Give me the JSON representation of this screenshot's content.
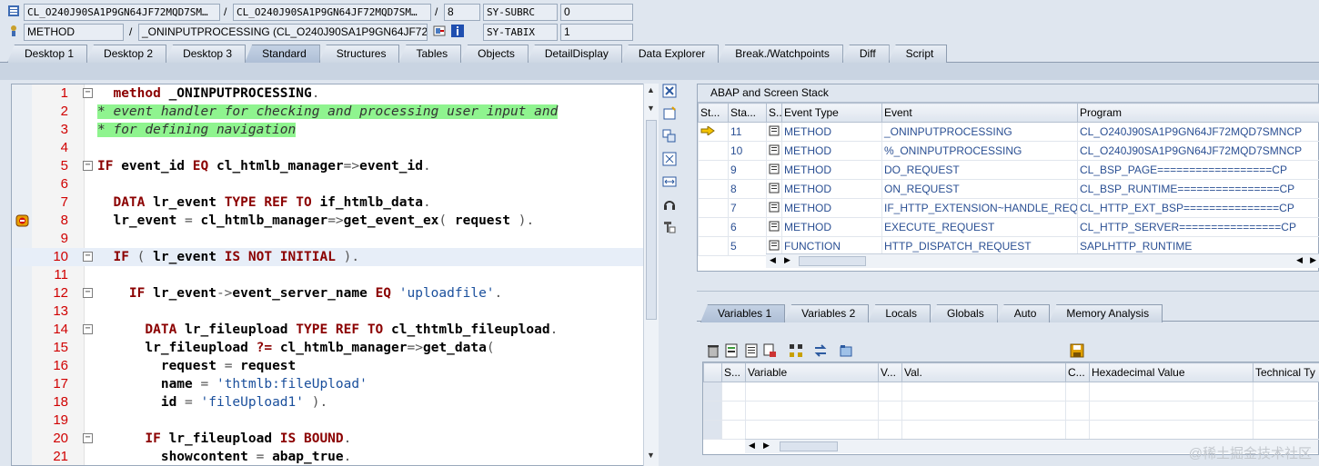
{
  "topbar": {
    "row1": {
      "class_field": "CL_O240J90SA1P9GN64JF72MQD7SM…",
      "class_field2": "CL_O240J90SA1P9GN64JF72MQD7SM…",
      "slash": "/",
      "line": "8",
      "sy_label": "SY-SUBRC",
      "sy_value": "0"
    },
    "row2": {
      "type_field": "METHOD",
      "slash": "/",
      "method_field": "_ONINPUTPROCESSING (CL_O240J90SA1P9GN64JF72…",
      "sy_label": "SY-TABIX",
      "sy_value": "1"
    }
  },
  "main_tabs": [
    "Desktop 1",
    "Desktop 2",
    "Desktop 3",
    "Standard",
    "Structures",
    "Tables",
    "Objects",
    "DetailDisplay",
    "Data Explorer",
    "Break./Watchpoints",
    "Diff",
    "Script"
  ],
  "active_main_tab": "Standard",
  "code": {
    "lines": [
      {
        "n": "1",
        "fold": "−",
        "html_key": "l1"
      },
      {
        "n": "2",
        "fold": "",
        "html_key": "l2"
      },
      {
        "n": "3",
        "fold": "",
        "html_key": "l3"
      },
      {
        "n": "4",
        "fold": "",
        "html_key": "l4"
      },
      {
        "n": "5",
        "fold": "−",
        "html_key": "l5"
      },
      {
        "n": "6",
        "fold": "",
        "html_key": "l6"
      },
      {
        "n": "7",
        "fold": "",
        "html_key": "l7"
      },
      {
        "n": "8",
        "fold": "",
        "html_key": "l8"
      },
      {
        "n": "9",
        "fold": "",
        "html_key": "l9"
      },
      {
        "n": "10",
        "fold": "−",
        "html_key": "l10"
      },
      {
        "n": "11",
        "fold": "",
        "html_key": "l11"
      },
      {
        "n": "12",
        "fold": "−",
        "html_key": "l12"
      },
      {
        "n": "13",
        "fold": "",
        "html_key": "l13"
      },
      {
        "n": "14",
        "fold": "−",
        "html_key": "l14"
      },
      {
        "n": "15",
        "fold": "",
        "html_key": "l15"
      },
      {
        "n": "16",
        "fold": "",
        "html_key": "l16"
      },
      {
        "n": "17",
        "fold": "",
        "html_key": "l17"
      },
      {
        "n": "18",
        "fold": "",
        "html_key": "l18"
      },
      {
        "n": "19",
        "fold": "",
        "html_key": "l19"
      },
      {
        "n": "20",
        "fold": "−",
        "html_key": "l20"
      },
      {
        "n": "21",
        "fold": "",
        "html_key": "l21"
      }
    ],
    "tokens": {
      "l1": [
        [
          "kw",
          "  method "
        ],
        [
          "plain",
          "_ONINPUTPROCESSING"
        ],
        [
          "sym",
          "."
        ]
      ],
      "l2": [
        [
          "cmt",
          "* event handler for checking and processing user input and"
        ]
      ],
      "l3": [
        [
          "cmt",
          "* for defining navigation"
        ]
      ],
      "l4": [],
      "l5": [
        [
          "kw",
          "IF "
        ],
        [
          "plain",
          "event_id "
        ],
        [
          "kw",
          "EQ "
        ],
        [
          "plain",
          "cl_htmlb_manager"
        ],
        [
          "sym",
          "=>"
        ],
        [
          "plain",
          "event_id"
        ],
        [
          "sym",
          "."
        ]
      ],
      "l6": [],
      "l7": [
        [
          "kw",
          "  DATA "
        ],
        [
          "plain",
          "lr_event "
        ],
        [
          "kw",
          "TYPE REF TO "
        ],
        [
          "plain",
          "if_htmlb_data"
        ],
        [
          "sym",
          "."
        ]
      ],
      "l8": [
        [
          "plain",
          "  lr_event "
        ],
        [
          "sym",
          "= "
        ],
        [
          "plain",
          "cl_htmlb_manager"
        ],
        [
          "sym",
          "=>"
        ],
        [
          "plain",
          "get_event_ex"
        ],
        [
          "sym",
          "( "
        ],
        [
          "plain",
          "request "
        ],
        [
          "sym",
          ")."
        ]
      ],
      "l9": [],
      "l10": [
        [
          "kw",
          "  IF "
        ],
        [
          "sym",
          "( "
        ],
        [
          "plain",
          "lr_event "
        ],
        [
          "kw",
          "IS NOT INITIAL "
        ],
        [
          "sym",
          ")."
        ]
      ],
      "l11": [],
      "l12": [
        [
          "kw",
          "    IF "
        ],
        [
          "plain",
          "lr_event"
        ],
        [
          "sym",
          "->"
        ],
        [
          "plain",
          "event_server_name "
        ],
        [
          "kw",
          "EQ "
        ],
        [
          "str",
          "'uploadfile'"
        ],
        [
          "sym",
          "."
        ]
      ],
      "l13": [],
      "l14": [
        [
          "kw",
          "      DATA "
        ],
        [
          "plain",
          "lr_fileupload "
        ],
        [
          "kw",
          "TYPE REF TO "
        ],
        [
          "plain",
          "cl_thtmlb_fileupload"
        ],
        [
          "sym",
          "."
        ]
      ],
      "l15": [
        [
          "plain",
          "      lr_fileupload "
        ],
        [
          "kw",
          "?= "
        ],
        [
          "plain",
          "cl_htmlb_manager"
        ],
        [
          "sym",
          "=>"
        ],
        [
          "plain",
          "get_data"
        ],
        [
          "sym",
          "("
        ]
      ],
      "l16": [
        [
          "plain",
          "        request "
        ],
        [
          "sym",
          "= "
        ],
        [
          "plain",
          "request"
        ]
      ],
      "l17": [
        [
          "plain",
          "        name "
        ],
        [
          "sym",
          "= "
        ],
        [
          "str",
          "'thtmlb:fileUpload'"
        ]
      ],
      "l18": [
        [
          "plain",
          "        id "
        ],
        [
          "sym",
          "= "
        ],
        [
          "str",
          "'fileUpload1'"
        ],
        [
          "sym",
          " )."
        ]
      ],
      "l19": [],
      "l20": [
        [
          "kw",
          "      IF "
        ],
        [
          "plain",
          "lr_fileupload "
        ],
        [
          "kw",
          "IS BOUND"
        ],
        [
          "sym",
          "."
        ]
      ],
      "l21": [
        [
          "plain",
          "        showcontent "
        ],
        [
          "sym",
          "= "
        ],
        [
          "plain",
          "abap_true"
        ],
        [
          "sym",
          "."
        ]
      ]
    }
  },
  "stack": {
    "title": "ABAP and Screen Stack",
    "columns": [
      "St...",
      "Sta...",
      "S...",
      "Event Type",
      "Event",
      "Program"
    ],
    "rows": [
      {
        "level": "11",
        "type": "METHOD",
        "event": "_ONINPUTPROCESSING",
        "program": "CL_O240J90SA1P9GN64JF72MQD7SMNCP",
        "current": true
      },
      {
        "level": "10",
        "type": "METHOD",
        "event": "%_ONINPUTPROCESSING",
        "program": "CL_O240J90SA1P9GN64JF72MQD7SMNCP",
        "current": false
      },
      {
        "level": "9",
        "type": "METHOD",
        "event": "DO_REQUEST",
        "program": "CL_BSP_PAGE==================CP",
        "current": false
      },
      {
        "level": "8",
        "type": "METHOD",
        "event": "ON_REQUEST",
        "program": "CL_BSP_RUNTIME================CP",
        "current": false
      },
      {
        "level": "7",
        "type": "METHOD",
        "event": "IF_HTTP_EXTENSION~HANDLE_REQ…",
        "program": "CL_HTTP_EXT_BSP===============CP",
        "current": false
      },
      {
        "level": "6",
        "type": "METHOD",
        "event": "EXECUTE_REQUEST",
        "program": "CL_HTTP_SERVER================CP",
        "current": false
      },
      {
        "level": "5",
        "type": "FUNCTION",
        "event": "HTTP_DISPATCH_REQUEST",
        "program": "SAPLHTTP_RUNTIME",
        "current": false
      }
    ]
  },
  "var_tabs": [
    "Variables 1",
    "Variables 2",
    "Locals",
    "Globals",
    "Auto",
    "Memory Analysis"
  ],
  "active_var_tab": "Variables 1",
  "vargrid": {
    "columns": [
      "S...",
      "Variable",
      "V...",
      "Val.",
      "C...",
      "Hexadecimal Value",
      "Technical Ty"
    ]
  },
  "watermark": "@稀土掘金技术社区"
}
